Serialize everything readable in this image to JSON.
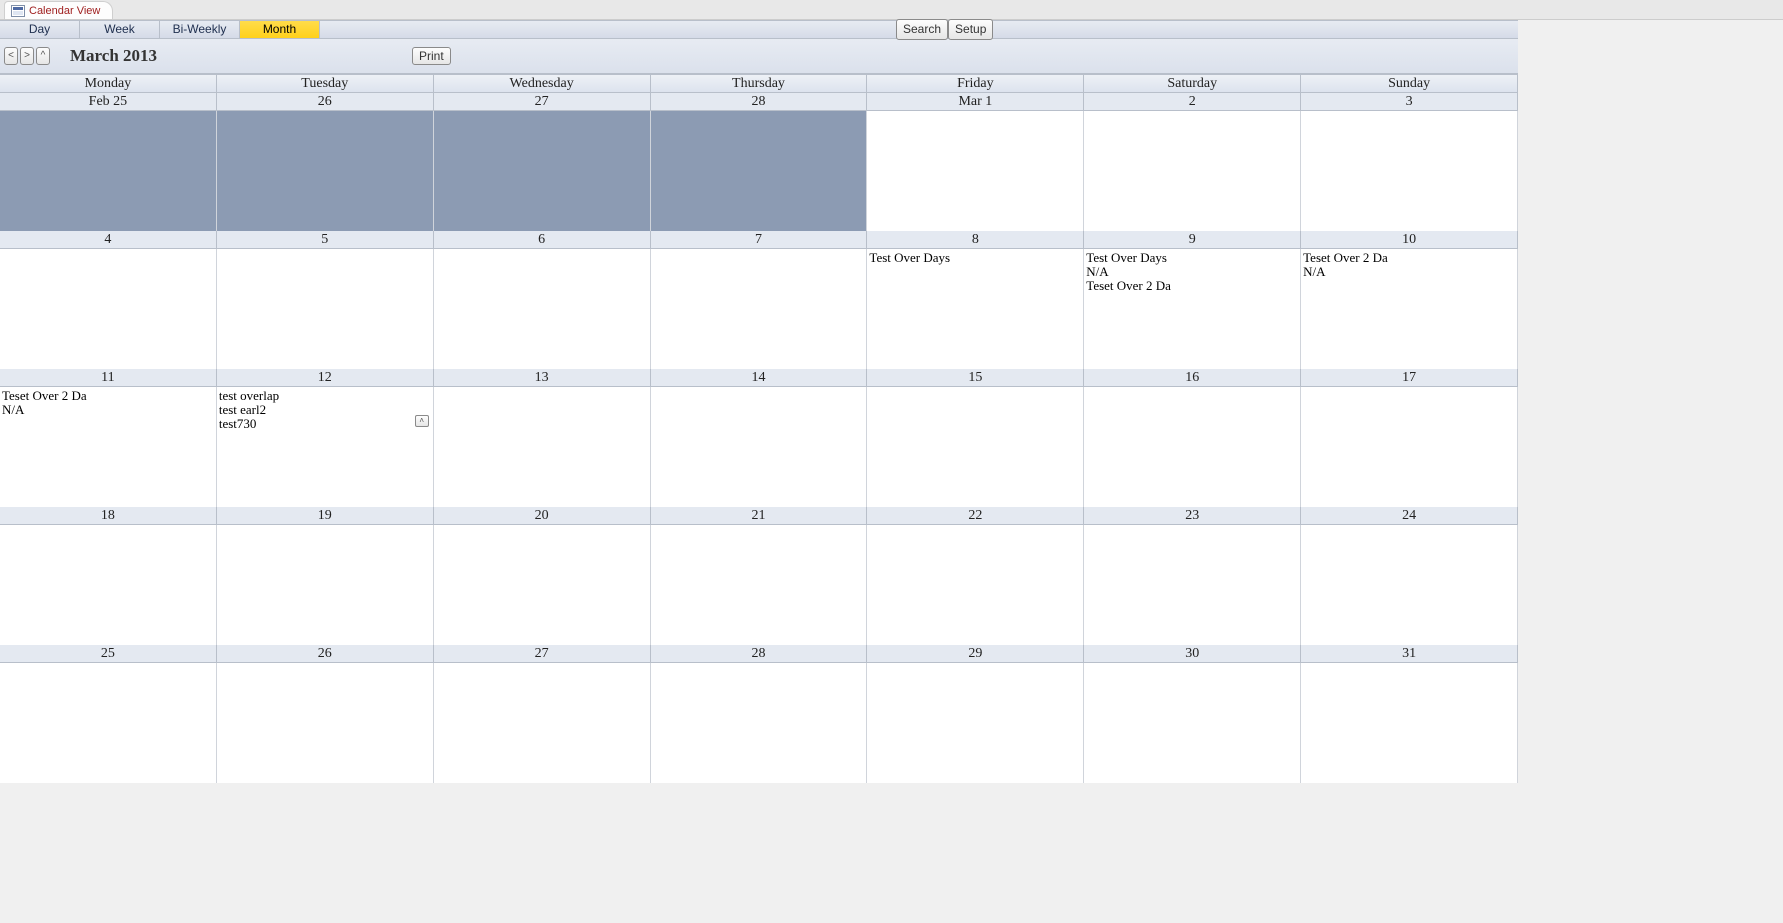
{
  "tab_title": "Calendar View",
  "view_tabs": {
    "day": "Day",
    "week": "Week",
    "biweekly": "Bi-Weekly",
    "month": "Month"
  },
  "active_view": "month",
  "buttons": {
    "search": "Search",
    "setup": "Setup",
    "print": "Print"
  },
  "nav": {
    "prev": "<",
    "next": ">",
    "today": "^"
  },
  "month_label": "March 2013",
  "days_of_week": [
    "Monday",
    "Tuesday",
    "Wednesday",
    "Thursday",
    "Friday",
    "Saturday",
    "Sunday"
  ],
  "weeks": [
    {
      "dates": [
        "Feb 25",
        "26",
        "27",
        "28",
        "Mar 1",
        "2",
        "3"
      ],
      "cells": [
        {
          "prev": true,
          "events": []
        },
        {
          "prev": true,
          "events": []
        },
        {
          "prev": true,
          "events": []
        },
        {
          "prev": true,
          "events": []
        },
        {
          "prev": false,
          "events": []
        },
        {
          "prev": false,
          "events": []
        },
        {
          "prev": false,
          "events": []
        }
      ]
    },
    {
      "dates": [
        "4",
        "5",
        "6",
        "7",
        "8",
        "9",
        "10"
      ],
      "cells": [
        {
          "prev": false,
          "events": []
        },
        {
          "prev": false,
          "events": []
        },
        {
          "prev": false,
          "events": []
        },
        {
          "prev": false,
          "events": []
        },
        {
          "prev": false,
          "events": [
            "Test Over Days"
          ]
        },
        {
          "prev": false,
          "events": [
            "Test Over Days",
            "N/A",
            "Teset Over 2 Da"
          ]
        },
        {
          "prev": false,
          "events": [
            "Teset Over 2 Da",
            "N/A"
          ]
        }
      ]
    },
    {
      "dates": [
        "11",
        "12",
        "13",
        "14",
        "15",
        "16",
        "17"
      ],
      "cells": [
        {
          "prev": false,
          "events": [
            "Teset Over 2 Da",
            "N/A"
          ]
        },
        {
          "prev": false,
          "events": [
            "test overlap",
            "test earl2",
            "test730"
          ],
          "expand": true
        },
        {
          "prev": false,
          "events": []
        },
        {
          "prev": false,
          "events": []
        },
        {
          "prev": false,
          "events": []
        },
        {
          "prev": false,
          "events": []
        },
        {
          "prev": false,
          "events": []
        }
      ]
    },
    {
      "dates": [
        "18",
        "19",
        "20",
        "21",
        "22",
        "23",
        "24"
      ],
      "cells": [
        {
          "prev": false,
          "events": []
        },
        {
          "prev": false,
          "events": []
        },
        {
          "prev": false,
          "events": []
        },
        {
          "prev": false,
          "events": []
        },
        {
          "prev": false,
          "events": []
        },
        {
          "prev": false,
          "events": []
        },
        {
          "prev": false,
          "events": []
        }
      ]
    },
    {
      "dates": [
        "25",
        "26",
        "27",
        "28",
        "29",
        "30",
        "31"
      ],
      "cells": [
        {
          "prev": false,
          "events": []
        },
        {
          "prev": false,
          "events": []
        },
        {
          "prev": false,
          "events": []
        },
        {
          "prev": false,
          "events": []
        },
        {
          "prev": false,
          "events": []
        },
        {
          "prev": false,
          "events": []
        },
        {
          "prev": false,
          "events": []
        }
      ]
    }
  ],
  "expand_glyph": "˄"
}
